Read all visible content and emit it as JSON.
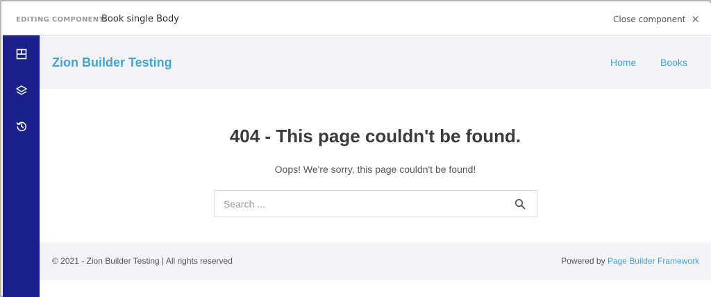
{
  "editor": {
    "editing_label": "EDITING COMPONENT:",
    "component_name": "Book single Body",
    "close_label": "Close component",
    "close_icon": "close-icon",
    "sidebar_icons": [
      "layout-grid-icon",
      "layers-icon",
      "history-icon"
    ],
    "sidebar_color": "#1a1f8c"
  },
  "site": {
    "title": "Zion Builder Testing",
    "accent": "#3fa6cf",
    "nav": [
      "Home",
      "Books"
    ]
  },
  "error": {
    "heading": "404 - This page couldn't be found.",
    "message": "Oops! We're sorry, this page couldn't be found!"
  },
  "search": {
    "placeholder": "Search ...",
    "value": "",
    "icon": "search-icon"
  },
  "footer": {
    "copyright": "© 2021 - Zion Builder Testing | All rights reserved",
    "powered_prefix": "Powered by",
    "powered_link": "Page Builder Framework"
  }
}
